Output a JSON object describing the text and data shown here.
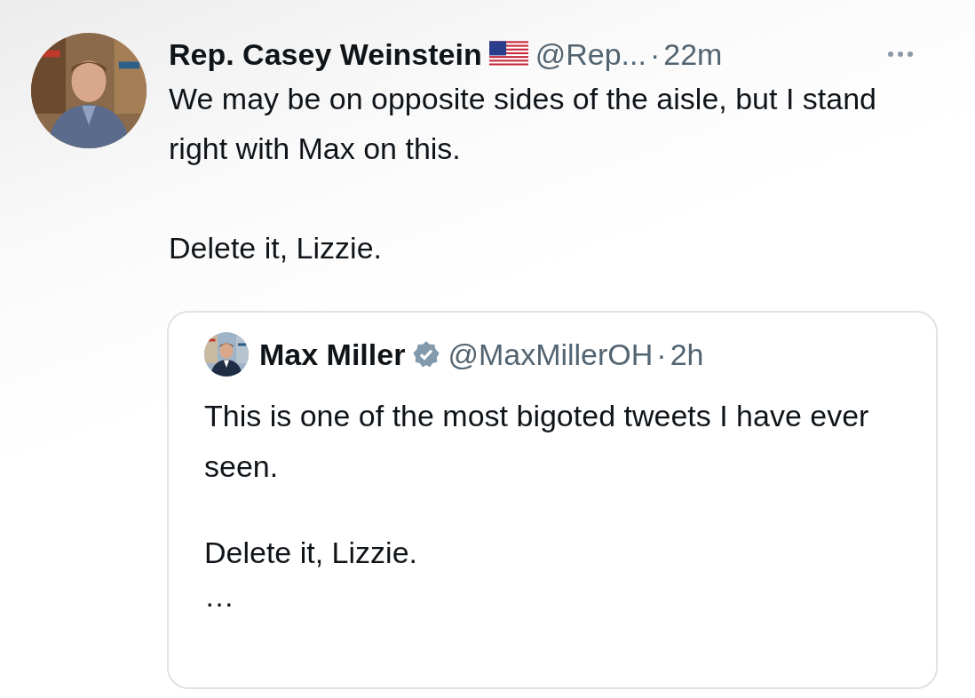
{
  "tweet": {
    "author": {
      "name": "Rep. Casey Weinstein",
      "handle": "@Rep...",
      "separator": "·",
      "time": "22m"
    },
    "paragraphs": [
      "We may be on opposite sides of the aisle, but I stand right with Max on this.",
      "Delete it, Lizzie."
    ],
    "quote": {
      "author": {
        "name": "Max Miller",
        "verified": true,
        "handle": "@MaxMillerOH",
        "separator": "·",
        "time": "2h"
      },
      "paragraphs": [
        "This is one of the most bigoted tweets I have ever seen.",
        "Delete it, Lizzie.",
        "…"
      ]
    }
  }
}
